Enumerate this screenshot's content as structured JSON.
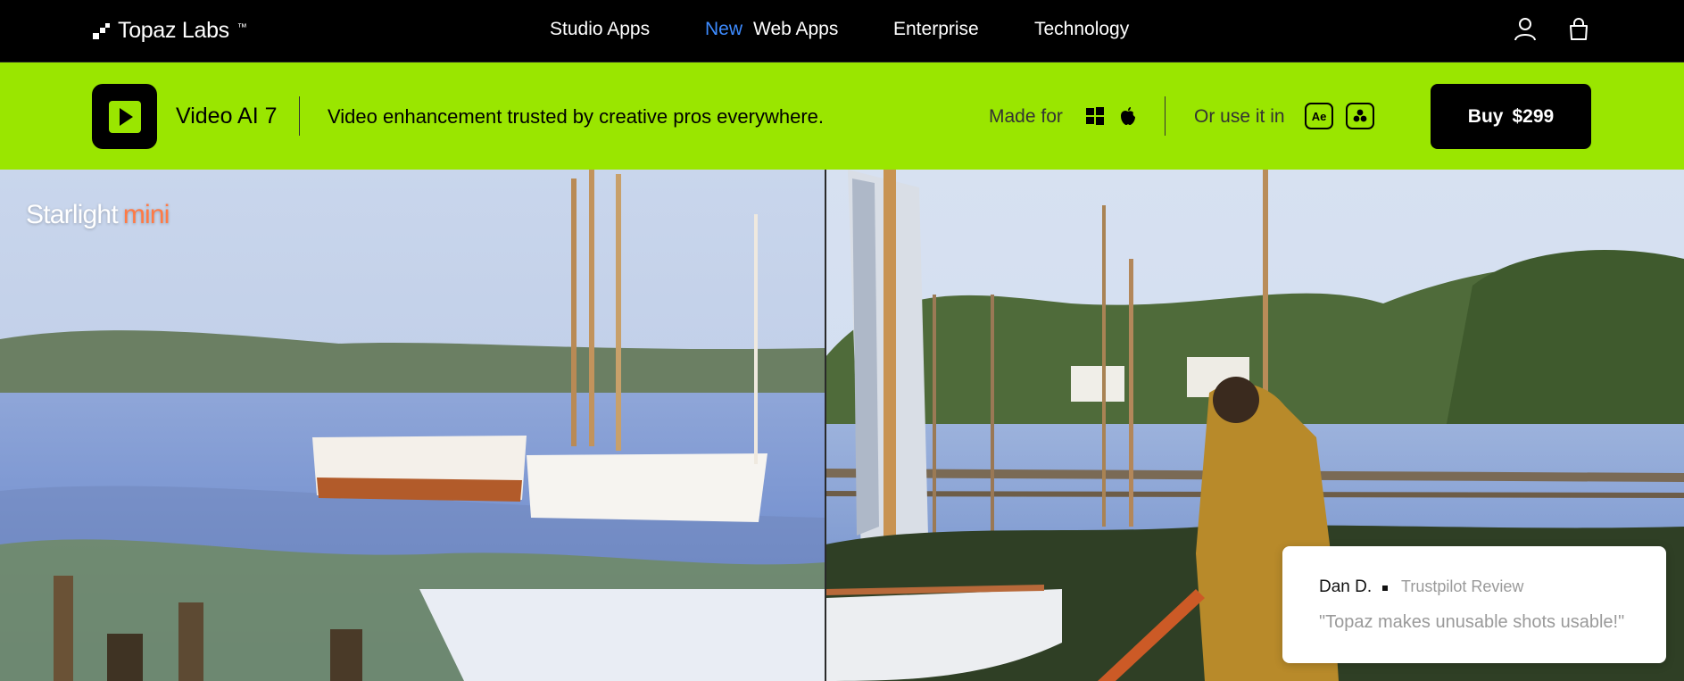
{
  "topnav": {
    "logo_text": "Topaz Labs",
    "logo_tm": "™",
    "links": {
      "studio_apps": "Studio Apps",
      "web_apps_badge": "New",
      "web_apps": "Web Apps",
      "enterprise": "Enterprise",
      "technology": "Technology"
    },
    "icons": [
      "user-icon",
      "shopping-bag-icon"
    ]
  },
  "productbar": {
    "app_name": "Video AI 7",
    "tagline": "Video enhancement trusted by creative pros everywhere.",
    "made_for_label": "Made for",
    "os_icons": [
      "windows-icon",
      "apple-icon"
    ],
    "use_in_label": "Or use it in",
    "plugins": {
      "after_effects": "Ae",
      "davinci_icon": "davinci-resolve-icon"
    },
    "buy_label": "Buy",
    "price": "$299",
    "accent_color": "#9ae600"
  },
  "hero": {
    "brand_title": "Starlight",
    "brand_accent": "mini",
    "accent_color": "#ff7a45",
    "review": {
      "author": "Dan D.",
      "source": "Trustpilot Review",
      "quote": "\"Topaz makes unusable shots usable!\""
    }
  }
}
